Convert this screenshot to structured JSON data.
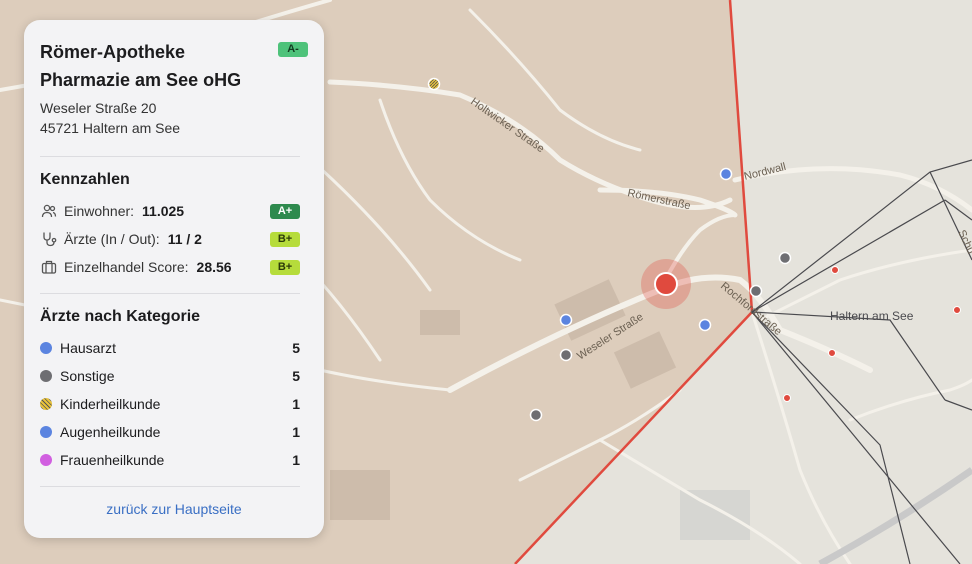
{
  "map": {
    "place_label": "Haltern am See",
    "streets": {
      "holtwicker": "Holtwicker Straße",
      "roemer": "Römerstraße",
      "nordwall": "Nordwall",
      "weseler": "Weseler Straße",
      "rochfor": "Rochfordstraße",
      "schu": "Schu"
    },
    "colors": {
      "hausarzt": "#5b84e0",
      "sonstige": "#6e6e72",
      "kinderheilkunde": "#e8c23a",
      "augenheilkunde": "#5b84e0",
      "frauenheilkunde": "#d15fe0",
      "selected": "#e04a3e",
      "boundary": "#e04a3e"
    }
  },
  "panel": {
    "title": "Römer-Apotheke Pharmazie am See oHG",
    "grade": "A-",
    "address_line1": "Weseler Straße 20",
    "address_line2": "45721 Haltern am See",
    "kennzahlen": {
      "heading": "Kennzahlen",
      "rows": [
        {
          "icon": "users-icon",
          "label": "Einwohner:",
          "value": "11.025",
          "grade": "A+"
        },
        {
          "icon": "stethoscope-icon",
          "label": "Ärzte (In / Out):",
          "value": "11 / 2",
          "grade": "B+"
        },
        {
          "icon": "briefcase-icon",
          "label": "Einzelhandel Score:",
          "value": "28.56",
          "grade": "B+"
        }
      ]
    },
    "categories": {
      "heading": "Ärzte nach Kategorie",
      "rows": [
        {
          "label": "Hausarzt",
          "count": "5",
          "color": "#5b84e0"
        },
        {
          "label": "Sonstige",
          "count": "5",
          "color": "#6e6e72"
        },
        {
          "label": "Kinderheilkunde",
          "count": "1",
          "color": "#e8c23a"
        },
        {
          "label": "Augenheilkunde",
          "count": "1",
          "color": "#5b84e0"
        },
        {
          "label": "Frauenheilkunde",
          "count": "1",
          "color": "#d15fe0"
        }
      ]
    },
    "back_link": "zurück zur Hauptseite"
  }
}
